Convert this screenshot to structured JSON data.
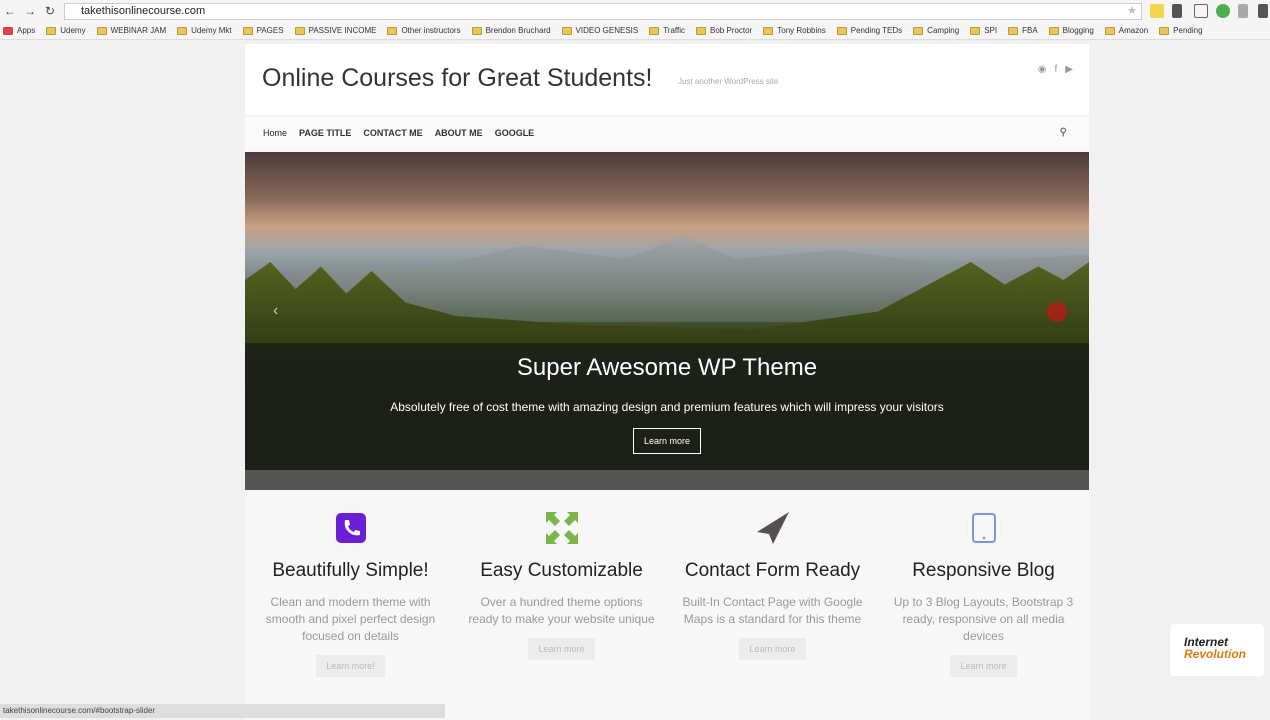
{
  "browser": {
    "url": "takethisonlinecourse.com",
    "status_url": "takethisonlinecourse.com/#bootstrap-slider",
    "bookmarks": [
      "Apps",
      "Udemy",
      "WEBINAR JAM",
      "Udemy Mkt",
      "PAGES",
      "PASSIVE INCOME",
      "Other instructors",
      "Brendon Bruchard",
      "VIDEO GENESIS",
      "Traffic",
      "Bob Proctor",
      "Tony Robbins",
      "Pending TEDs",
      "Camping",
      "SPI",
      "FBA",
      "Blogging",
      "Amazon",
      "Pending"
    ]
  },
  "site": {
    "title": "Online Courses for Great Students!",
    "tagline": "Just another WordPress site",
    "nav": [
      "Home",
      "PAGE TITLE",
      "CONTACT ME",
      "ABOUT ME",
      "GOOGLE"
    ]
  },
  "hero": {
    "heading": "Super Awesome WP Theme",
    "text": "Absolutely free of cost theme with amazing design and premium features which will impress your visitors",
    "button": "Learn more"
  },
  "features": [
    {
      "icon": "phone-icon",
      "color": "#6a1fd6",
      "title": "Beautifully Simple!",
      "text": "Clean and modern theme with smooth and pixel perfect design focused on details",
      "button": "Learn more!"
    },
    {
      "icon": "expand-arrows-icon",
      "color": "#7ab648",
      "title": "Easy Customizable",
      "text": "Over a hundred theme options ready to make your website unique",
      "button": "Learn more"
    },
    {
      "icon": "paper-plane-icon",
      "color": "#555050",
      "title": "Contact Form Ready",
      "text": "Built-In Contact Page with Google Maps is a standard for this theme",
      "button": "Learn more"
    },
    {
      "icon": "tablet-icon",
      "color": "#7b96e0",
      "title": "Responsive Blog",
      "text": "Up to 3 Blog Layouts, Bootstrap 3 ready, responsive on all media devices",
      "button": "Learn more"
    }
  ],
  "watermark": {
    "line1": "Internet",
    "line2": "Revolution"
  }
}
